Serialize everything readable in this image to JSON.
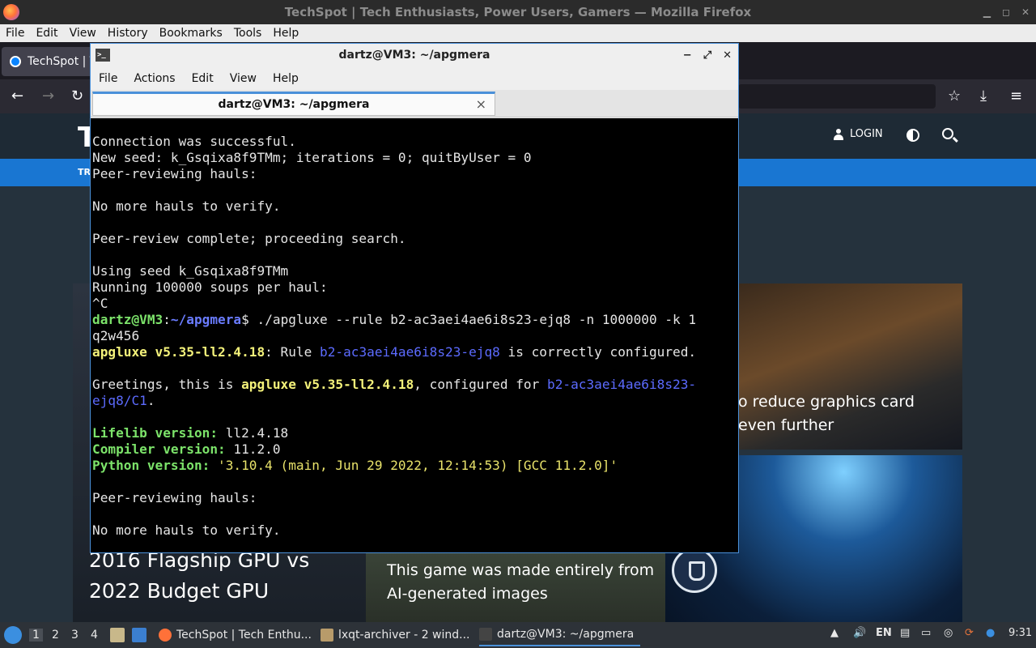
{
  "firefox": {
    "title": "TechSpot | Tech Enthusiasts, Power Users, Gamers — Mozilla Firefox",
    "menu": [
      "File",
      "Edit",
      "View",
      "History",
      "Bookmarks",
      "Tools",
      "Help"
    ],
    "tab_label": "TechSpot | T"
  },
  "site": {
    "logo": "T",
    "login": "LOGIN",
    "nav_partial": "TR",
    "card_right_top_caption_1": "o reduce graphics card",
    "card_right_top_caption_2": "even further",
    "card_left_caption_1": "2016 Flagship GPU vs",
    "card_left_caption_2": "2022 Budget GPU",
    "card_mid_caption_1": "This game was made entirely from",
    "card_mid_caption_2": "AI-generated images"
  },
  "terminal": {
    "title": "dartz@VM3: ~/apgmera",
    "menu": [
      "File",
      "Actions",
      "Edit",
      "View",
      "Help"
    ],
    "tab_label": "dartz@VM3: ~/apgmera",
    "tab_close": "×",
    "lines": {
      "l1": "Connection was successful.",
      "l2": "New seed: k_Gsqixa8f9TMm; iterations = 0; quitByUser = 0",
      "l3": "Peer-reviewing hauls:",
      "l5": "No more hauls to verify.",
      "l7": "Peer-review complete; proceeding search.",
      "l9": "Using seed k_Gsqixa8f9TMm",
      "l10": "Running 100000 soups per haul:",
      "l11": "^C",
      "prompt_user": "dartz@VM3",
      "prompt_colon": ":",
      "prompt_path": "~/apgmera",
      "prompt_cmd": "$ ./apgluxe --rule b2-ac3aei4ae6i8s23-ejq8 -n 1000000 -k 1",
      "l13": "q2w456",
      "l14_a": "apgluxe v5.35-ll2.4.18",
      "l14_b": ": Rule ",
      "l14_c": "b2-ac3aei4ae6i8s23-ejq8",
      "l14_d": " is correctly configured.",
      "l16_a": "Greetings, this is ",
      "l16_b": "apgluxe v5.35-ll2.4.18",
      "l16_c": ", configured for ",
      "l16_d": "b2-ac3aei4ae6i8s23-",
      "l17_a": "ejq8/C1",
      "l17_b": ".",
      "l19_a": "Lifelib version:",
      "l19_b": " ll2.4.18",
      "l20_a": "Compiler version:",
      "l20_b": " 11.2.0",
      "l21_a": "Python version:",
      "l21_b": " '3.10.4 (main, Jun 29 2022, 12:14:53) [GCC 11.2.0]'",
      "l23": "Peer-reviewing hauls:",
      "l25": "No more hauls to verify."
    }
  },
  "taskbar": {
    "workspaces": [
      "1",
      "2",
      "3",
      "4"
    ],
    "tasks": [
      "TechSpot | Tech Enthu...",
      "lxqt-archiver - 2 wind...",
      "dartz@VM3: ~/apgmera"
    ],
    "lang": "EN",
    "time": "9:31"
  }
}
